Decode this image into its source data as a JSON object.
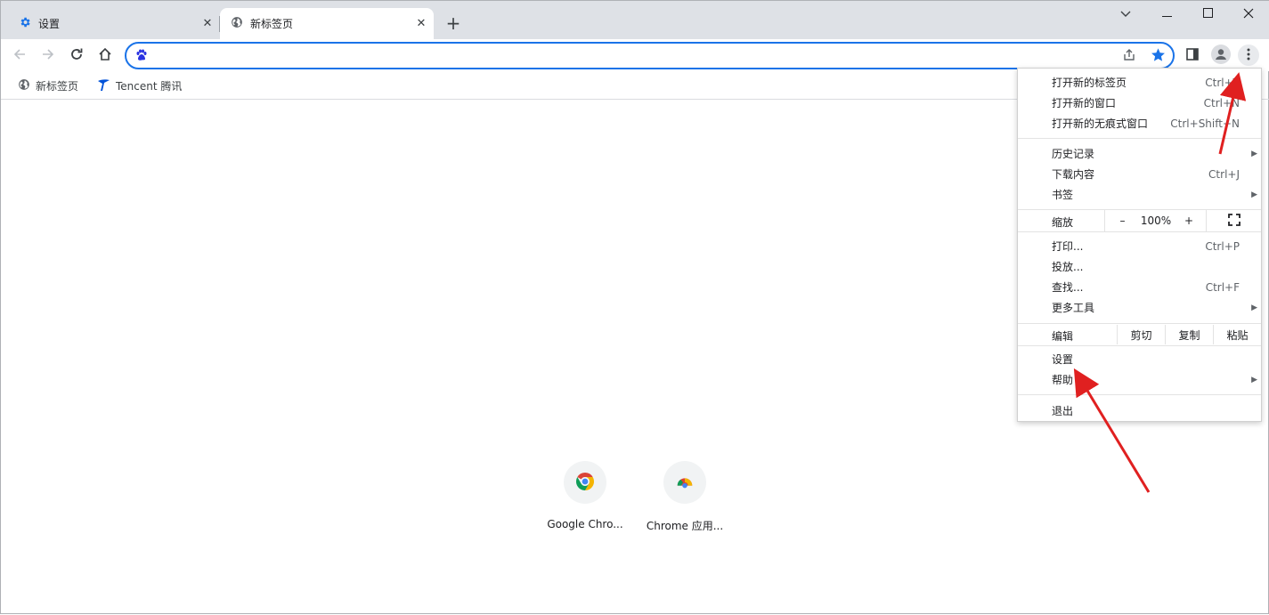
{
  "tabs": [
    {
      "title": "设置",
      "icon": "gear-icon"
    },
    {
      "title": "新标签页",
      "icon": "globe-icon"
    }
  ],
  "omnibox": {
    "value": "",
    "placeholder": "",
    "search_engine_icon": "baidu-paw-icon"
  },
  "bookmarks": [
    {
      "label": "新标签页",
      "icon": "globe-icon"
    },
    {
      "label": "Tencent 腾讯",
      "icon": "tencent-logo-icon"
    }
  ],
  "shortcuts": [
    {
      "label": "Google Chro...",
      "icon": "chrome-logo-icon"
    },
    {
      "label": "Chrome 应用...",
      "icon": "chrome-apps-icon"
    }
  ],
  "menu": {
    "new_tab": {
      "label": "打开新的标签页",
      "shortcut": "Ctrl+T"
    },
    "new_window": {
      "label": "打开新的窗口",
      "shortcut": "Ctrl+N"
    },
    "new_incognito": {
      "label": "打开新的无痕式窗口",
      "shortcut": "Ctrl+Shift+N"
    },
    "history": {
      "label": "历史记录"
    },
    "downloads": {
      "label": "下载内容",
      "shortcut": "Ctrl+J"
    },
    "bookmarks": {
      "label": "书签"
    },
    "zoom": {
      "label": "缩放",
      "minus": "–",
      "value": "100%",
      "plus": "+"
    },
    "print": {
      "label": "打印...",
      "shortcut": "Ctrl+P"
    },
    "cast": {
      "label": "投放..."
    },
    "find": {
      "label": "查找...",
      "shortcut": "Ctrl+F"
    },
    "more_tools": {
      "label": "更多工具"
    },
    "edit": {
      "label": "编辑",
      "cut": "剪切",
      "copy": "复制",
      "paste": "粘贴"
    },
    "settings": {
      "label": "设置"
    },
    "help": {
      "label": "帮助"
    },
    "exit": {
      "label": "退出"
    }
  },
  "colors": {
    "accent": "#1a73e8",
    "annotation": "#e02020"
  }
}
